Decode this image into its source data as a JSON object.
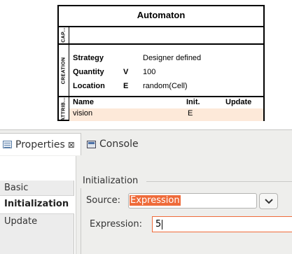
{
  "entity": {
    "title": "Automaton",
    "cap_label": "CAP...",
    "creation_label": "CREATION",
    "attrib_label": "ATTRIB...",
    "creation_rows": [
      {
        "name": "Strategy",
        "flag": "",
        "value": "Designer defined"
      },
      {
        "name": "Quantity",
        "flag": "V",
        "value": "100"
      },
      {
        "name": "Location",
        "flag": "E",
        "value": "random(Cell)"
      }
    ],
    "attr_headers": {
      "name": "Name",
      "init": "Init.",
      "update": "Update"
    },
    "attr_rows": [
      {
        "name": "vision",
        "init": "E",
        "update": ""
      }
    ]
  },
  "tabs": {
    "properties": "Properties",
    "close": "⊠",
    "console": "Console"
  },
  "sidebar": {
    "items": [
      "Basic",
      "Initialization",
      "Update"
    ]
  },
  "form": {
    "group_title": "Initialization",
    "source_label": "Source:",
    "source_value": "Expression",
    "expression_label": "Expression:",
    "expression_value": "5"
  }
}
